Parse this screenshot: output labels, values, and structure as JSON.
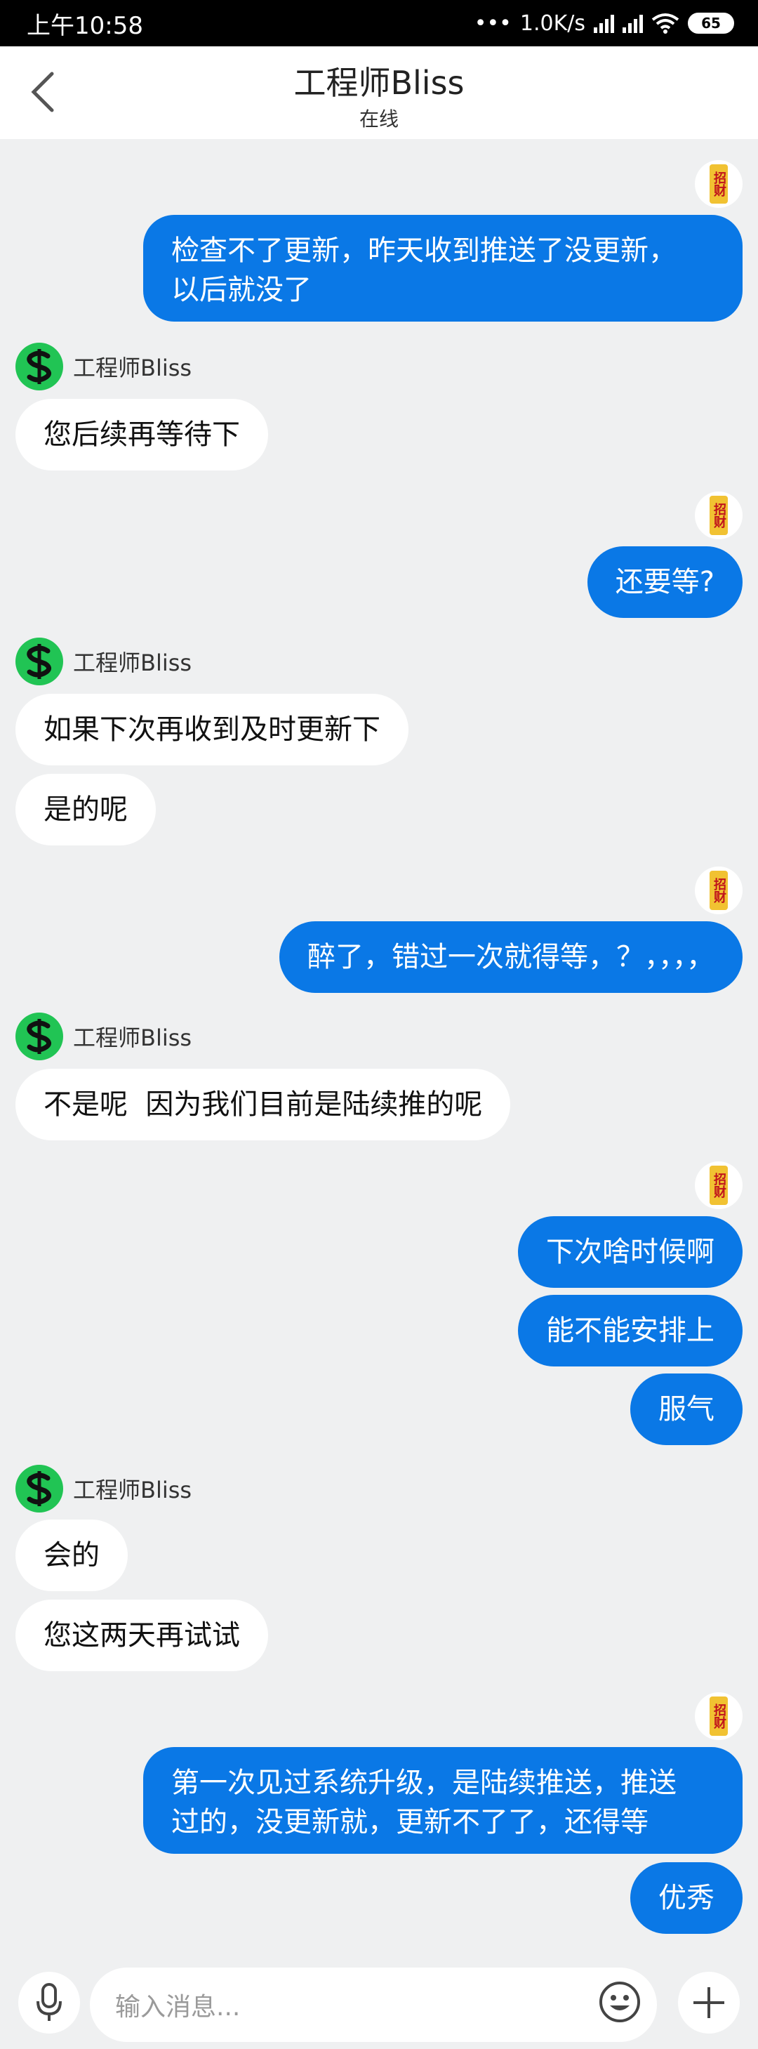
{
  "status_bar": {
    "time": "上午10:58",
    "speed": "1.0K/s",
    "battery": "65"
  },
  "header": {
    "title": "工程师Bliss",
    "status": "在线"
  },
  "badge_text": "招财",
  "agent_name": "工程师Bliss",
  "messages": [
    {
      "from": "me",
      "lines": [
        "检查不了更新，昨天收到推送了没更新，",
        "以后就没了"
      ]
    },
    {
      "from": "agent",
      "text": "您后续再等待下"
    },
    {
      "from": "me",
      "text": "还要等?"
    },
    {
      "from": "agent",
      "text": "如果下次再收到及时更新下"
    },
    {
      "from": "agent",
      "text": "是的呢"
    },
    {
      "from": "me",
      "text": "醉了，错过一次就得等，？，，，，"
    },
    {
      "from": "agent",
      "text": "不是呢  因为我们目前是陆续推的呢"
    },
    {
      "from": "me",
      "text": "下次啥时候啊"
    },
    {
      "from": "me",
      "text": "能不能安排上"
    },
    {
      "from": "me",
      "text": "服气"
    },
    {
      "from": "agent",
      "text": "会的"
    },
    {
      "from": "agent",
      "text": "您这两天再试试"
    },
    {
      "from": "me",
      "lines": [
        "第一次见过系统升级，是陆续推送，推送",
        "过的，没更新就，更新不了了，还得等"
      ]
    },
    {
      "from": "me",
      "text": "优秀"
    }
  ],
  "input": {
    "placeholder": "输入消息..."
  },
  "icons": {
    "back": "chevron-left-icon",
    "mic": "microphone-icon",
    "emoji": "smiley-icon",
    "plus": "plus-icon",
    "agent_avatar": "dollar-s-logo"
  },
  "colors": {
    "my_bubble": "#0a78e6",
    "agent_avatar": "#21c454",
    "background": "#eff0f1"
  }
}
